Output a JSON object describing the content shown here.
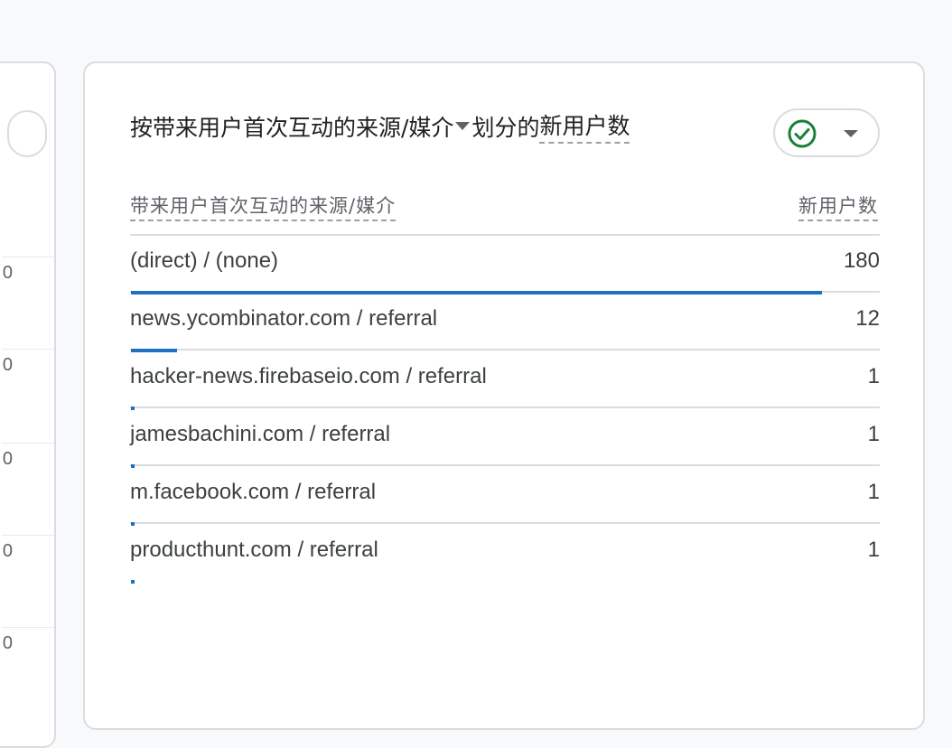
{
  "left_card": {
    "tick_labels": [
      "0",
      "0",
      "0",
      "0",
      "0"
    ]
  },
  "card": {
    "title_part1": "按带来用户首次互动的来源/媒介",
    "title_part2": "划分的",
    "title_metric": "新用户数",
    "compare_status": "check-circle-icon",
    "column_dimension": "带来用户首次互动的来源/媒介",
    "column_metric": "新用户数",
    "max_value": 180,
    "rows": [
      {
        "label": "(direct) / (none)",
        "value": "180",
        "bar_value": 180
      },
      {
        "label": "news.ycombinator.com / referral",
        "value": "12",
        "bar_value": 12
      },
      {
        "label": "hacker-news.firebaseio.com / referral",
        "value": "1",
        "bar_value": 1
      },
      {
        "label": "jamesbachini.com / referral",
        "value": "1",
        "bar_value": 1
      },
      {
        "label": "m.facebook.com / referral",
        "value": "1",
        "bar_value": 1
      },
      {
        "label": "producthunt.com / referral",
        "value": "1",
        "bar_value": 1
      }
    ]
  },
  "colors": {
    "accent": "#1f6fc2",
    "check_green": "#188038",
    "border": "#dadce0"
  }
}
